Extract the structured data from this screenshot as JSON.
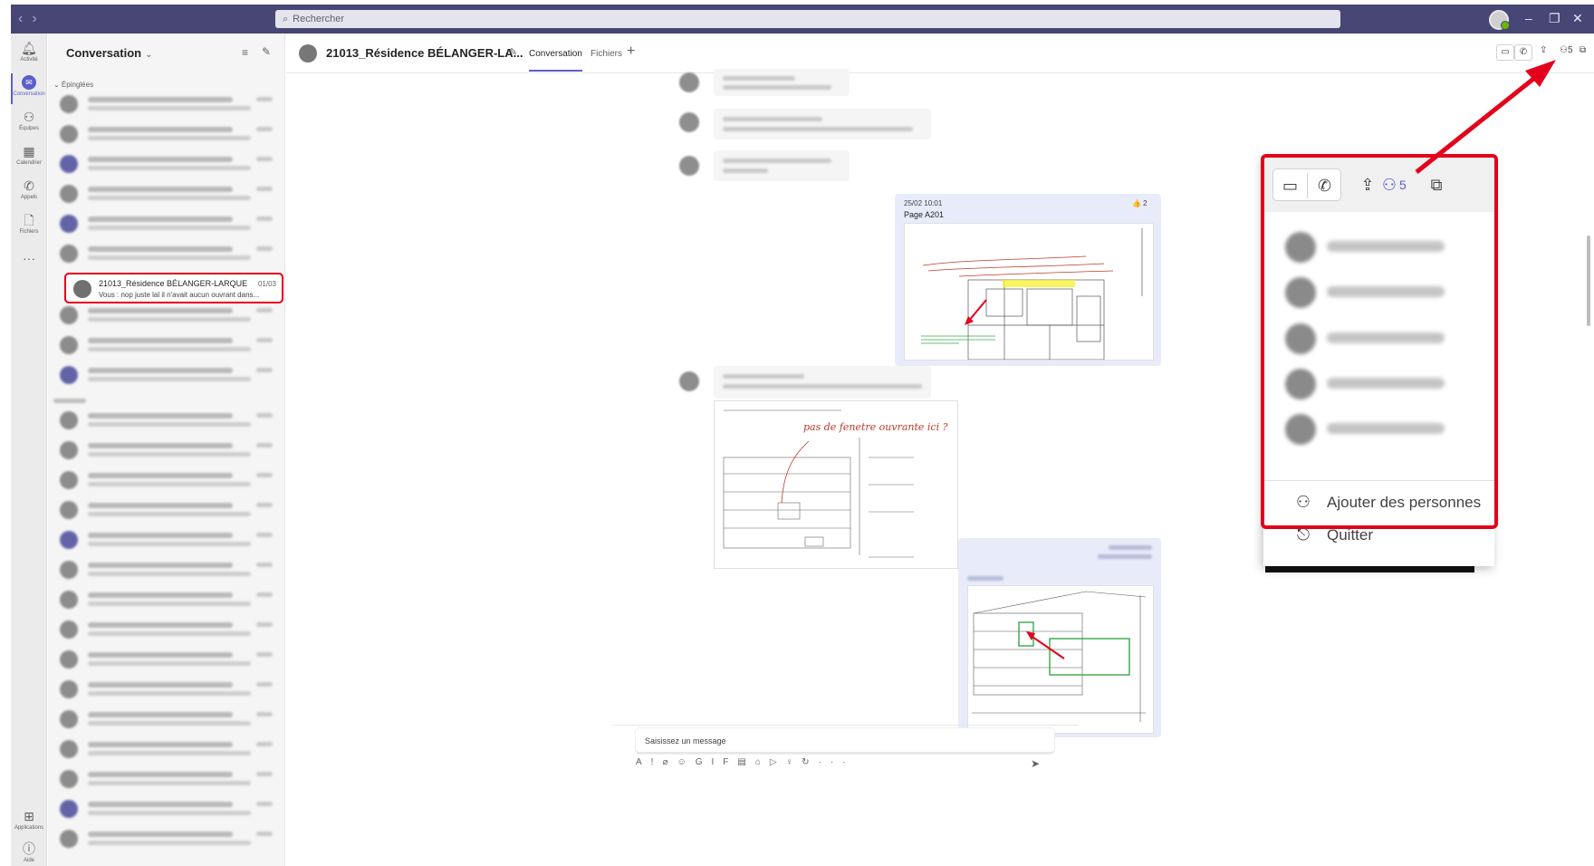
{
  "titlebar": {
    "back_icon": "chevron-left-icon",
    "forward_icon": "chevron-right-icon",
    "search_placeholder": "Rechercher",
    "window_controls": [
      "–",
      "❐",
      "✕"
    ]
  },
  "appbar": {
    "items": [
      {
        "label": "Activité",
        "icon": "bell-icon"
      },
      {
        "label": "Conversation",
        "icon": "chat-icon"
      },
      {
        "label": "Équipes",
        "icon": "teams-icon"
      },
      {
        "label": "Calendrier",
        "icon": "calendar-icon"
      },
      {
        "label": "Appels",
        "icon": "phone-icon"
      },
      {
        "label": "Fichiers",
        "icon": "file-icon"
      }
    ],
    "more": "···",
    "bottom": [
      {
        "label": "Applications",
        "icon": "apps-icon"
      },
      {
        "label": "Aide",
        "icon": "help-icon"
      }
    ]
  },
  "chatlist": {
    "title": "Conversation",
    "title_chevron": "⌄",
    "section_pinned": "⌄ Épinglées",
    "selected_chat": {
      "name": "21013_Résidence BÉLANGER-LARQUE...",
      "date": "01/03",
      "preview": "Vous : nop juste lal il n'avait aucun ouvrant dans..."
    }
  },
  "chat_header": {
    "title": "21013_Résidence BÉLANGER-LA...",
    "tabs": [
      "Conversation",
      "Fichiers"
    ],
    "add_tab": "+",
    "participant_count": "5"
  },
  "messages": {
    "msg1": {
      "time": "25/02 10:01",
      "text": "Page A201",
      "reaction": "👍 2"
    },
    "msg2_annotation": "pas de fenetre ouvrante ici ?"
  },
  "compose": {
    "placeholder": "Saisissez un message",
    "tools": [
      "A",
      "!",
      "⌀",
      "☺",
      "GIF",
      "▤",
      "⌂",
      "▷",
      "♀",
      "↻",
      "···"
    ],
    "send_icon": "send-icon"
  },
  "popup": {
    "participant_count": "5",
    "menu": {
      "add_people": "Ajouter des personnes",
      "leave": "Quitter"
    }
  },
  "colors": {
    "titlebar": "#464775",
    "accent": "#5b5fc7",
    "highlight_red": "#e3001b"
  }
}
